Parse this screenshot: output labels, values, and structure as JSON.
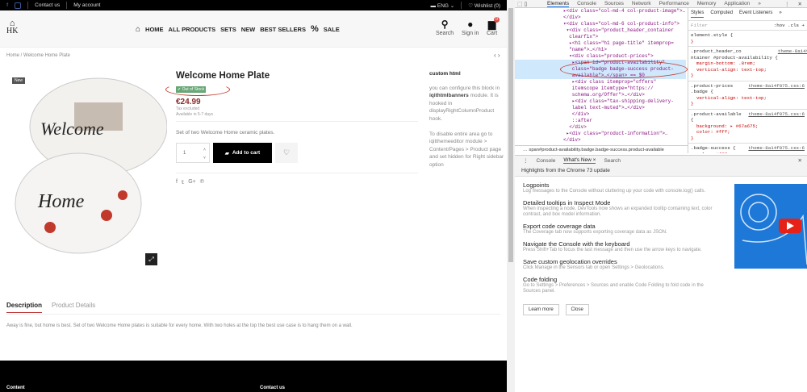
{
  "topbar": {
    "contact": "Contact us",
    "account": "My account",
    "lang": "ENG",
    "wishlist": "Wishlist (0)"
  },
  "header": {
    "logo": "HK",
    "nav": [
      "HOME",
      "ALL PRODUCTS",
      "SETS",
      "NEW",
      "BEST SELLERS",
      "SALE"
    ],
    "search": "Search",
    "signin": "Sign in",
    "cart": "Cart",
    "cart_count": "0"
  },
  "breadcrumb": [
    "Home",
    "Welcome Home Plate"
  ],
  "product": {
    "new_label": "New",
    "title": "Welcome Home Plate",
    "availability": "Out of Stock",
    "price": "€24.99",
    "tax": "Tax excluded",
    "delivery": "Available in 5-7 days",
    "short_desc": "Set of two Welcome Home ceramic plates.",
    "qty": "1",
    "add_to_cart": "Add to cart",
    "plate_text_1": "Welcome",
    "plate_text_2": "Home"
  },
  "sidebar": {
    "title": "custom html",
    "p1a": "you can configure this block in ",
    "p1b": "iqithtmlbanners",
    "p1c": " module. It is hooked in displayRightColumnProduct hook.",
    "p2": "To disable entire area go to iqitthemeeditor module > Content/Pages > Product page and set hidden for Right sidebar option"
  },
  "tabs": {
    "description": "Description",
    "details": "Product Details",
    "text": "Away is fine, but home is best. Set of two Welcome Home plates is suitable for every home. With two holes at the top the best use case is to hang them on a wall."
  },
  "footer": {
    "content": "Content",
    "contact": "Contact us"
  },
  "devtools": {
    "tabs": [
      "Elements",
      "Console",
      "Sources",
      "Network",
      "Performance",
      "Memory",
      "Application",
      "»"
    ],
    "dom": [
      "▸<div class=\"col-md-4 col-product-image\">…",
      "</div>",
      "▾<div class=\"col-md-6 col-product-info\">",
      " ▾<div class=\"product_header_container",
      "  clearfix\">",
      "  ▸<h1 class=\"h1 page-title\" itemprop=",
      "  \"name\">…</h1>",
      "  ▾<div class=\"product-prices\">",
      "   ▸<span id=\"product-availability\"",
      "   class=\"badge badge-success product-",
      "   available\">…</span> == $0",
      "   ▸<div class itemprop=\"offers\"",
      "   itemscope itemtype=\"https://",
      "   schema.org/Offer\">…</div>",
      "   ▸<div class=\"tax-shipping-delivery-",
      "   label text-muted\">…</div>",
      "   </div>",
      "   ::after",
      "  </div>",
      " ▸<div class=\"product-information\">…",
      "</div>"
    ],
    "breadcrumb": "span#product-availability.badge.badge-success.product-available",
    "styles_tabs": [
      "Styles",
      "Computed",
      "Event Listeners",
      "»"
    ],
    "filter": "Filter",
    "hov": ":hov .cls +",
    "rules": [
      {
        "sel": "element.style {",
        "link": "",
        "body": "}"
      },
      {
        "sel": ".product_header_co\nntainer #product-availability {",
        "link": "theme-8a14f075.css:6",
        "body": "  margin-bottom: .8rem;\n  vertical-align: text-top;\n}"
      },
      {
        "sel": ".product-prices\n.badge {",
        "link": "theme-8a14f075.css:6",
        "body": "  vertical-align: text-top;\n}"
      },
      {
        "sel": ".product-available\n{",
        "link": "theme-8a14f075.css:6",
        "body": "  background: ▸ #67a675;\n  color: #fff;\n}"
      },
      {
        "sel": ".badge-success {",
        "link": "theme-8a14f075.css:6",
        "body": "  color: #fff"
      }
    ],
    "drawer_tabs": [
      "Console",
      "What's New ×",
      "Search"
    ],
    "highlights": "Highlights from the Chrome 73 update",
    "items": [
      {
        "h": "Logpoints",
        "d": "Log messages to the Console without cluttering up your code with console.log() calls."
      },
      {
        "h": "Detailed tooltips in Inspect Mode",
        "d": "When inspecting a node, DevTools now shows an expanded tooltip containing text, color contrast, and box model information."
      },
      {
        "h": "Export code coverage data",
        "d": "The Coverage tab now supports exporting coverage data as JSON."
      },
      {
        "h": "Navigate the Console with the keyboard",
        "d": "Press Shift+Tab to focus the last message and then use the arrow keys to navigate."
      },
      {
        "h": "Save custom geolocation overrides",
        "d": "Click Manage in the Sensors tab or open Settings > Geolocations."
      },
      {
        "h": "Code folding",
        "d": "Go to Settings > Preferences > Sources and enable Code Folding to fold code in the Sources panel."
      }
    ],
    "learn_more": "Learn more",
    "close": "Close"
  },
  "colors": {
    "badge": "#67a675",
    "price": "#8a2a2a",
    "accent": "#1a73e8"
  }
}
